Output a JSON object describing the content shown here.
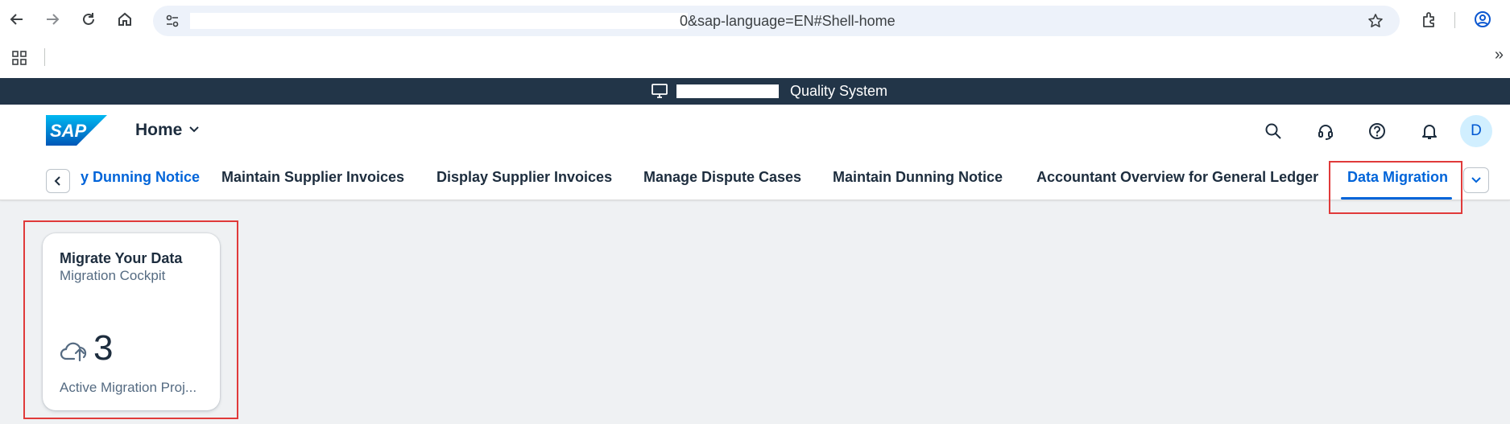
{
  "browser": {
    "url_visible": "0&sap-language=EN#Shell-home",
    "icons": [
      "back-icon",
      "forward-icon",
      "reload-icon",
      "home-icon",
      "site-info-icon",
      "bookmark-star-icon",
      "extensions-icon",
      "profile-icon",
      "apps-icon",
      "more-bookmarks-icon"
    ],
    "more_bookmarks": "»"
  },
  "system_bar": {
    "system_name": "Quality System"
  },
  "shell": {
    "home_label": "Home",
    "avatar_initial": "D",
    "tabs": [
      {
        "label": "y Dunning Notice",
        "state": "partial"
      },
      {
        "label": "Maintain Supplier Invoices",
        "state": "normal"
      },
      {
        "label": "Display Supplier Invoices",
        "state": "normal"
      },
      {
        "label": "Manage Dispute Cases",
        "state": "normal"
      },
      {
        "label": "Maintain Dunning Notice",
        "state": "normal"
      },
      {
        "label": "Accountant Overview for General Ledger",
        "state": "normal"
      },
      {
        "label": "Data Migration",
        "state": "active"
      }
    ]
  },
  "tile": {
    "title": "Migrate Your Data",
    "subtitle": "Migration Cockpit",
    "number": "3",
    "footer": "Active Migration Proj..."
  },
  "colors": {
    "accent": "#0064d9",
    "system_bar": "#223548",
    "highlight": "#e03a3a",
    "page_bg": "#eff1f3"
  }
}
